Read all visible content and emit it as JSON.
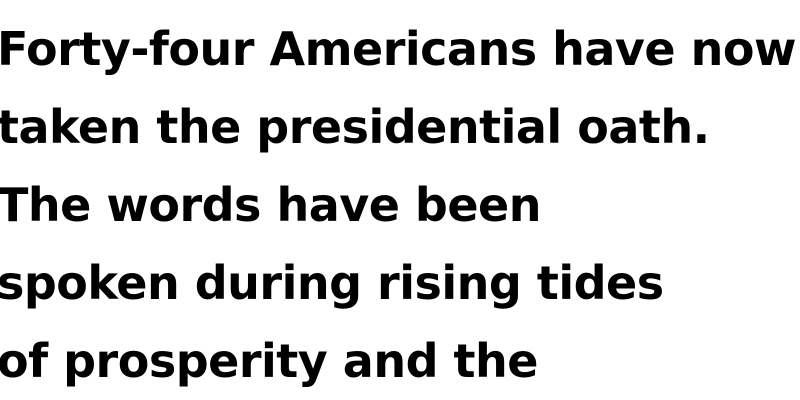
{
  "document": {
    "lines": [
      "Forty-four Americans have now",
      "taken the presidential oath.",
      "The words have been",
      "spoken during rising tides",
      "of prosperity and the"
    ]
  },
  "colors": {
    "text": "#000000",
    "background": "#ffffff"
  }
}
